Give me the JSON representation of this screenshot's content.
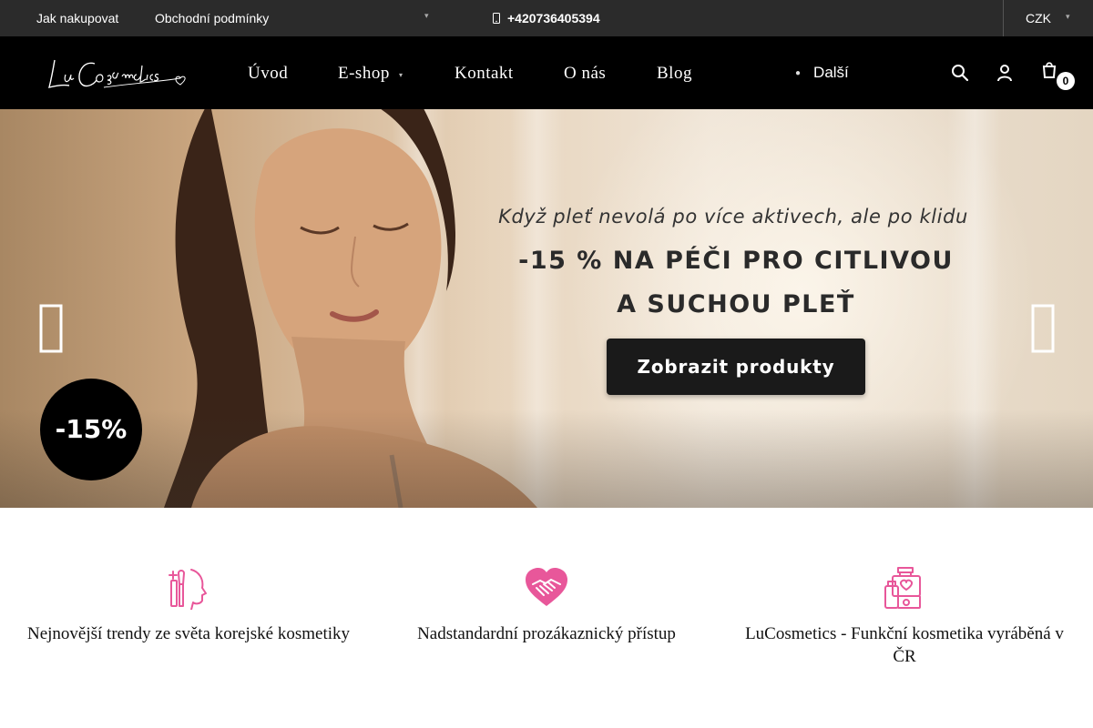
{
  "topbar": {
    "link_how_to_buy": "Jak nakupovat",
    "link_terms": "Obchodní podmínky",
    "phone": "+420736405394",
    "currency": "CZK"
  },
  "header": {
    "logo_text": "LuCosmetics",
    "nav": [
      {
        "label": "Úvod"
      },
      {
        "label": "E-shop"
      },
      {
        "label": "Kontakt"
      },
      {
        "label": "O nás"
      },
      {
        "label": "Blog"
      }
    ],
    "more_label": "Další",
    "cart_count": "0"
  },
  "hero": {
    "subtitle": "Když pleť nevolá po více aktivech, ale po klidu",
    "headline_1": "-15 % NA PÉČI PRO CITLIVOU",
    "headline_2": "A SUCHOU PLEŤ",
    "cta_label": "Zobrazit produkty",
    "badge": "-15%"
  },
  "features": [
    {
      "icon": "makeup-brush-icon",
      "text": "Nejnovější trendy ze světa korejské kosmetiky"
    },
    {
      "icon": "heart-handshake-icon",
      "text": "Nadstandardní prozákaznický přístup"
    },
    {
      "icon": "cosmetics-bottle-icon",
      "text": "LuCosmetics - Funkční kosmetika vyráběná v ČR"
    }
  ],
  "colors": {
    "topbar_bg": "#2b2b2b",
    "header_bg": "#000000",
    "accent_pink": "#e8579a",
    "cta_bg": "#1a1a1a"
  }
}
